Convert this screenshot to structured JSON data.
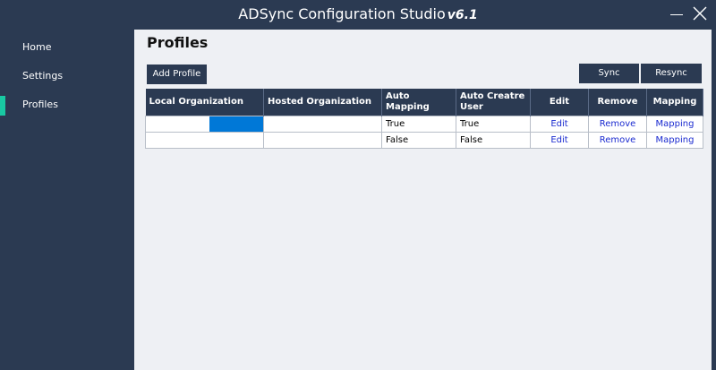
{
  "window": {
    "title": "ADSync Configuration Studio",
    "version": "v6.1"
  },
  "sidebar": {
    "items": [
      {
        "label": "Home"
      },
      {
        "label": "Settings"
      },
      {
        "label": "Profiles",
        "active": true
      }
    ]
  },
  "colors": {
    "chrome": "#2b3a52",
    "accent": "#19c9a3",
    "link": "#1a2ad0",
    "selection": "#0078d7"
  },
  "main": {
    "title": "Profiles",
    "add_profile_label": "Add Profile",
    "sync_label": "Sync",
    "resync_label": "Resync",
    "table": {
      "columns": [
        "Local Organization",
        "Hosted Organization",
        "Auto Mapping",
        "Auto Creatre User",
        "Edit",
        "Remove",
        "Mapping"
      ],
      "rows": [
        {
          "local": "",
          "hosted": "",
          "auto_mapping": "True",
          "auto_create": "True",
          "edit": "Edit",
          "remove": "Remove",
          "mapping": "Mapping"
        },
        {
          "local": "",
          "hosted": "",
          "auto_mapping": "False",
          "auto_create": "False",
          "edit": "Edit",
          "remove": "Remove",
          "mapping": "Mapping"
        }
      ]
    }
  }
}
